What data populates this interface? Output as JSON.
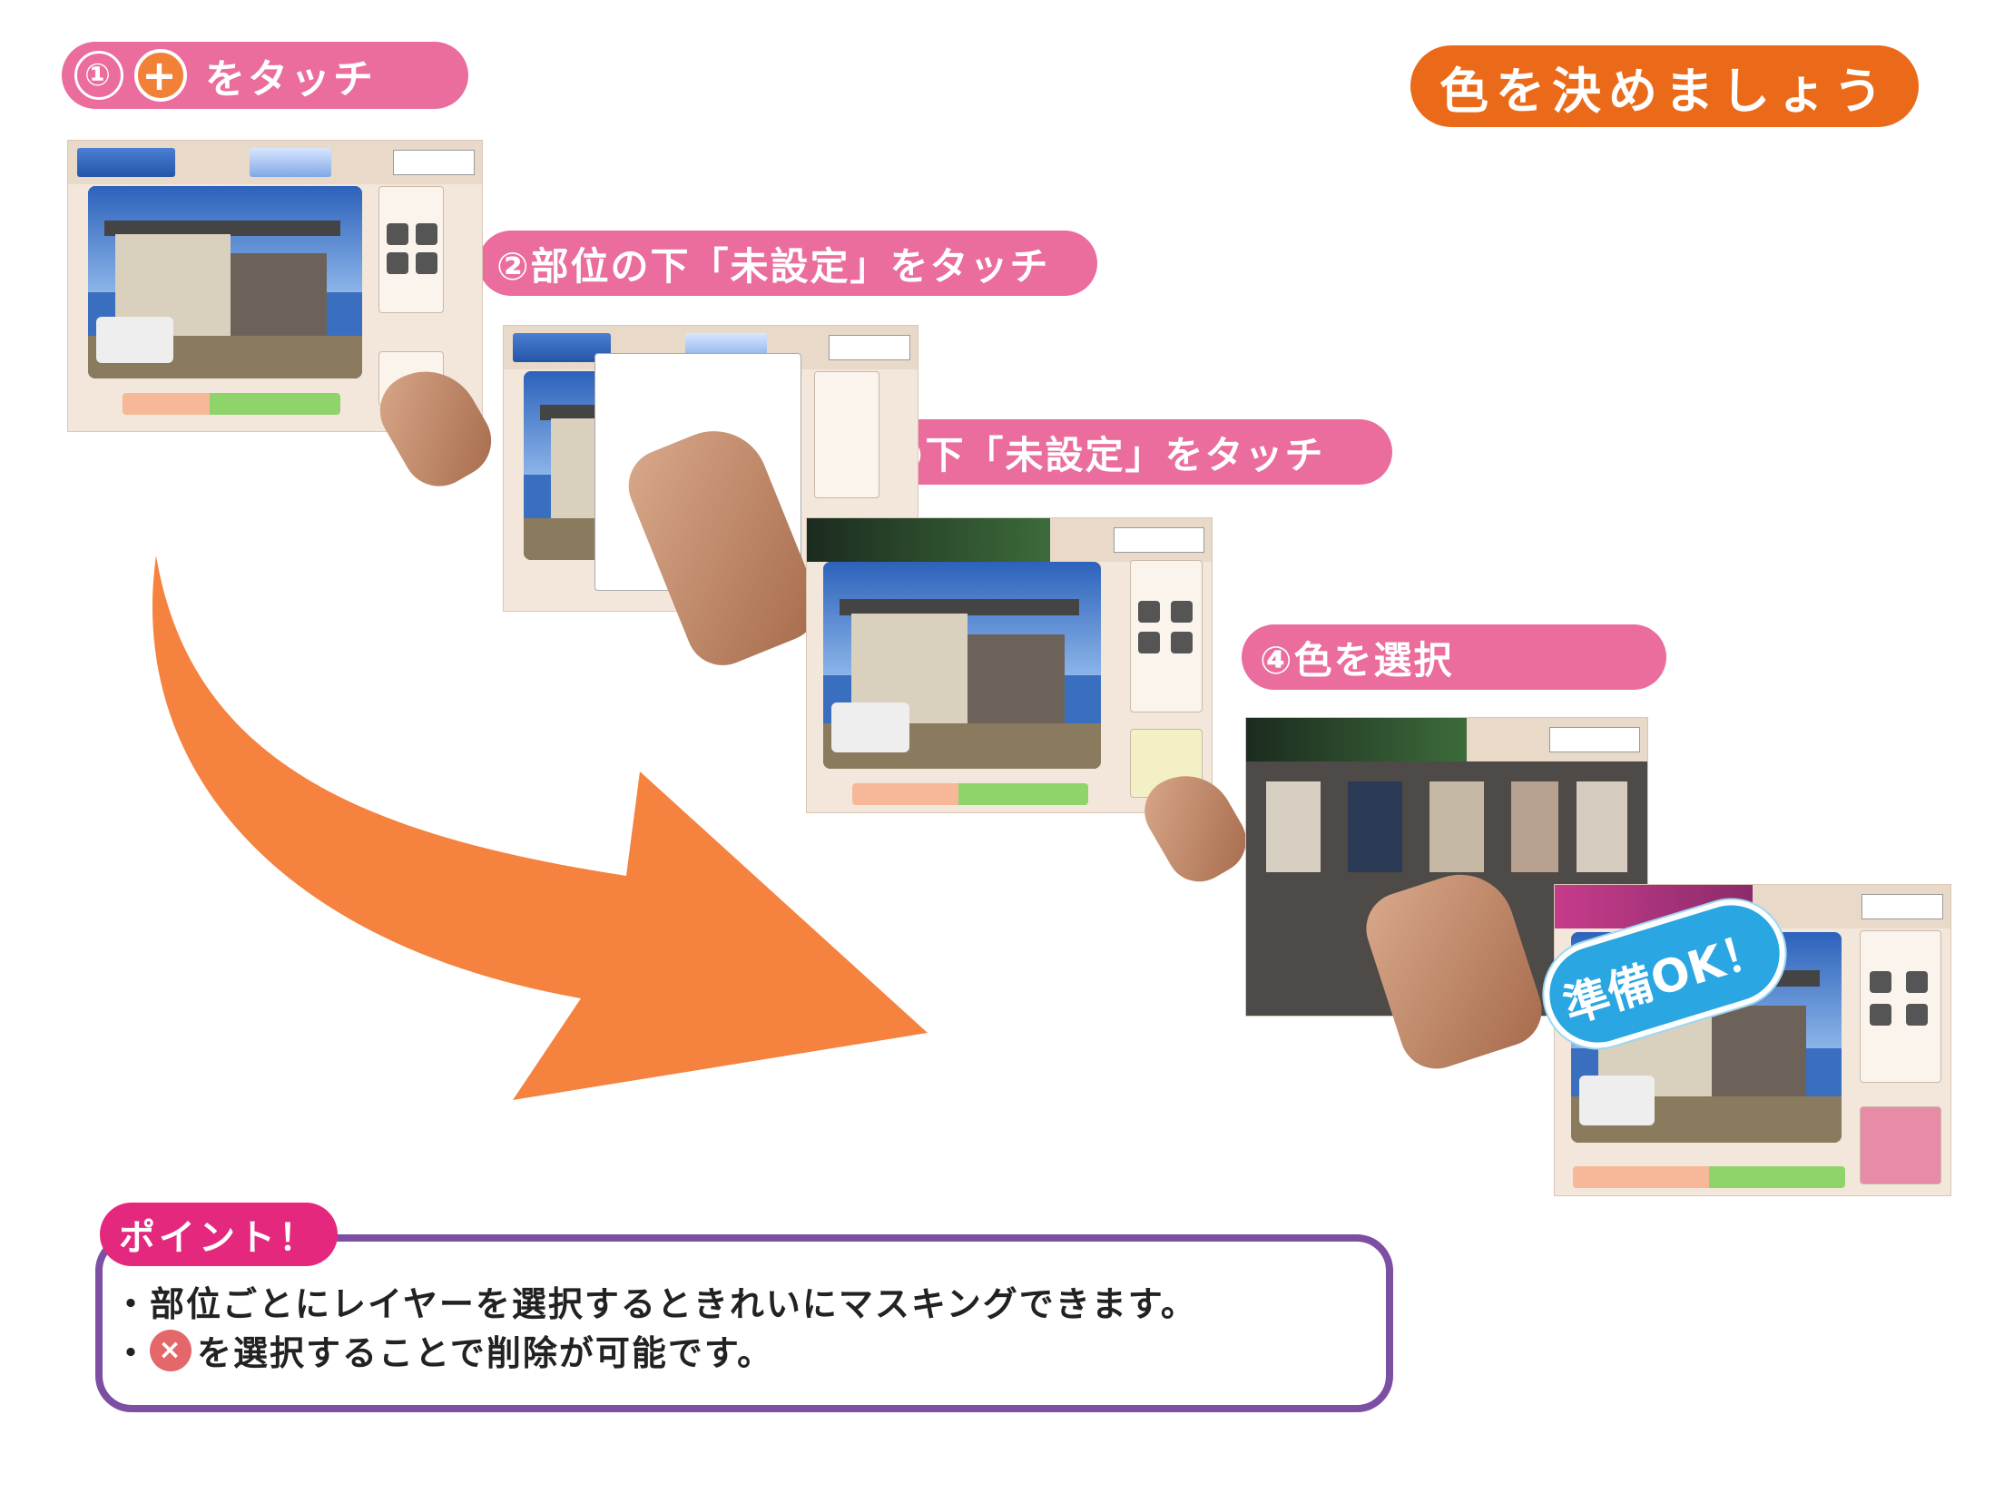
{
  "title": "色を決めましょう",
  "steps": {
    "step1": {
      "num": "①",
      "plus": "+",
      "text": "をタッチ"
    },
    "step2": {
      "text": "②部位の下「未設定」をタッチ"
    },
    "step3": {
      "text": "③色の下「未設定」をタッチ"
    },
    "step4": {
      "text": "④色を選択"
    }
  },
  "ok_badge": "準備OK！",
  "point": {
    "label": "ポイント！",
    "line1": "・部位ごとにレイヤーを選択するときれいにマスキングできます。",
    "line2_bullet": "・",
    "x_icon": "×",
    "line2": "を選択することで削除が可能です。"
  },
  "colors": {
    "pill": "#ea6d9d",
    "title": "#eb6a1a",
    "arrow": "#f5823f",
    "point_border": "#7c4fa2",
    "ok_badge": "#2aa6e2"
  }
}
